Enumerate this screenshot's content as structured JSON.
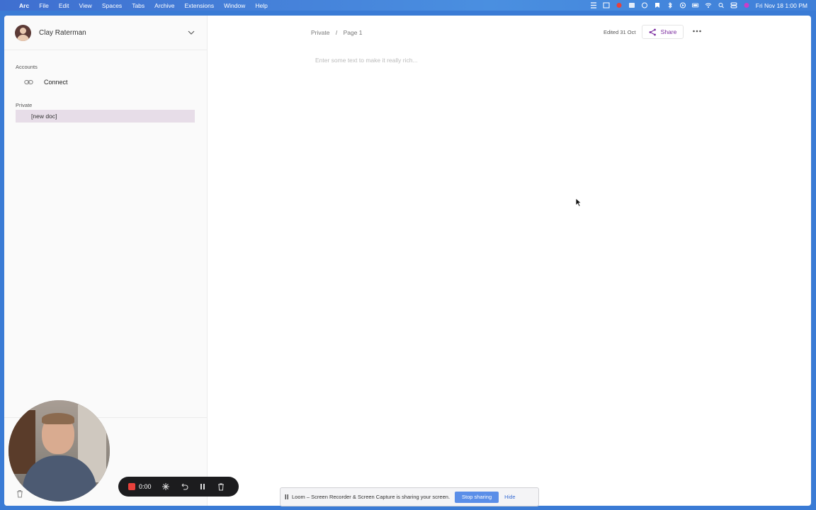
{
  "menubar": {
    "apple": "",
    "items": [
      "Arc",
      "File",
      "Edit",
      "View",
      "Spaces",
      "Tabs",
      "Archive",
      "Extensions",
      "Window",
      "Help"
    ],
    "clock": "Fri Nov 18  1:00 PM"
  },
  "sidebar": {
    "user_name": "Clay Raterman",
    "accounts_label": "Accounts",
    "connect_label": "Connect",
    "private_label": "Private",
    "doc_label": "[new doc]"
  },
  "header": {
    "breadcrumb_space": "Private",
    "breadcrumb_sep": "/",
    "breadcrumb_page": "Page 1",
    "edited": "Edited 31 Oct",
    "share_label": "Share"
  },
  "editor": {
    "placeholder": "Enter some text to make it really rich..."
  },
  "loom": {
    "timer": "0:00"
  },
  "banner": {
    "text": "Loom – Screen Recorder & Screen Capture is sharing your screen.",
    "stop_label": "Stop sharing",
    "hide_label": "Hide"
  },
  "colors": {
    "accent": "#7a2a9e",
    "selected_doc": "#e7dde8",
    "record": "#e8413b",
    "banner_button": "#5a8ee8"
  }
}
